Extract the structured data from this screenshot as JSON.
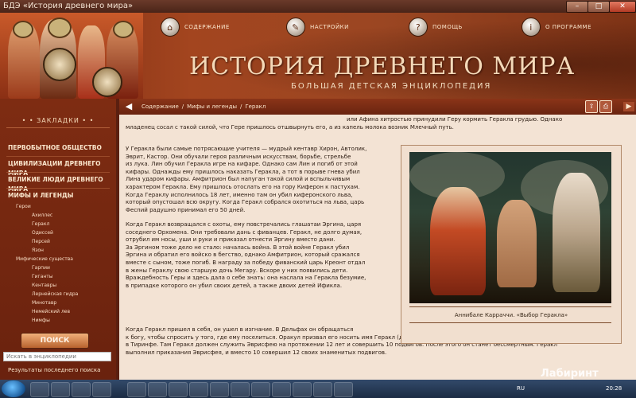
{
  "window": {
    "title": "БДЭ «История древнего мира»"
  },
  "menu": [
    {
      "label": "СОДЕРЖАНИЕ",
      "icon": "home-icon"
    },
    {
      "label": "НАСТРОЙКИ",
      "icon": "wrench-icon"
    },
    {
      "label": "ПОМОЩЬ",
      "icon": "help-icon"
    },
    {
      "label": "О ПРОГРАММЕ",
      "icon": "info-icon"
    }
  ],
  "brand": {
    "title": "ИСТОРИЯ ДРЕВНЕГО МИРА",
    "subtitle": "БОЛЬШАЯ ДЕТСКАЯ ЭНЦИКЛОПЕДИЯ"
  },
  "sidebar": {
    "bookmarks_title": "• • ЗАКЛАДКИ • •",
    "main": [
      "ПЕРВОБЫТНОЕ ОБЩЕСТВО",
      "ЦИВИЛИЗАЦИИ ДРЕВНЕГО МИРА",
      "ВЕЛИКИЕ ЛЮДИ ДРЕВНЕГО МИРА",
      "МИФЫ И ЛЕГЕНДЫ"
    ],
    "tree": [
      "Герои",
      "Ахиллес",
      "Геракл",
      "Одиссей",
      "Персей",
      "Язон",
      "Мифические существа",
      "Гарпии",
      "Гиганты",
      "Кентавры",
      "Лернейская гидра",
      "Минотавр",
      "Немейский лев",
      "Нимфы"
    ],
    "search_button": "ПОИСК",
    "search_placeholder": "Искать в энциклопедии",
    "last_results": "Результаты последнего поиска"
  },
  "breadcrumb": [
    "Содержание",
    "/",
    "Мифы и легенды",
    "/",
    "Геракл"
  ],
  "article": {
    "intro": [
      "или Афина хитростью принудили Геру кормить Геракла грудью. Однако",
      "младенец сосал с такой силой, что Гере пришлось отшвырнуть его, а из капель молока возник Млечный путь."
    ],
    "p1": [
      "У Геракла были самые потрясающие учителя — мудрый кентавр Хирон, Автолик,",
      "Эврит, Кастор. Они обучали героя различным искусствам, борьбе, стрельбе",
      "из лука. Лин обучил Геракла игре на кифаре. Однако сам Лин и погиб от этой",
      "кифары. Однажды ему пришлось наказать Геракла, а тот в порыве гнева убил",
      "Лина ударом кифары. Амфитрион был напуган такой силой и вспыльчивым",
      "характером Геракла. Ему пришлось отослать его на гору Киферон к пастухам.",
      "Когда Гераклу исполнилось 18 лет, именно там он убил киферонского льва,",
      "который опустошал всю округу. Когда Геракл собрался охотиться на льва, царь",
      "Феспий радушно принимал его 50 дней."
    ],
    "p2": [
      "Когда Геракл возвращался с охоты, ему повстречались глашатаи Эргина, царя",
      "соседнего Орхомена. Они требовали дань с фиванцев. Геракл, не долго думая,",
      "отрубил им носы, уши и руки и приказал отнести Эргину вместо дани.",
      "За Эргином тоже дело не стало: началась война. В этой войне Геракл убил",
      "Эргина и обратил его войско в бегство, однако Амфитрион, который сражался",
      "вместе с сыном, тоже погиб. В награду за победу фиванский царь Креонт отдал",
      "в жены Гераклу свою старшую дочь Мегару. Вскоре у них появились дети.",
      "Враждебность Геры и здесь дала о себе знать: она наслала на Геракла безумие,",
      "в припадке которого он убил своих детей, а также двоих детей Ификла."
    ],
    "p3": [
      "Когда Геракл пришел в себя, он ушел в изгнание. В Дельфах он обращаться",
      "к богу, чтобы спросить у того, где ему поселиться. Оракул призвал его носить имя Геракл (до этого он был Алкидом) и велел поселиться",
      "в Тиринфе. Там Геракл должен служить Эврисфею на протяжении 12 лет и совершить 10 подвигов. После этого он станет бессмертным. Геракл",
      "выполнил приказания Эврисфея, и вместо 10 совершил 12 своих знаменитых подвигов."
    ],
    "caption": "Аннибале Карраччи. «Выбор Геракла»"
  },
  "taskbar": {
    "lang": "RU",
    "time": "20:28"
  },
  "watermark": "Лабиринт"
}
